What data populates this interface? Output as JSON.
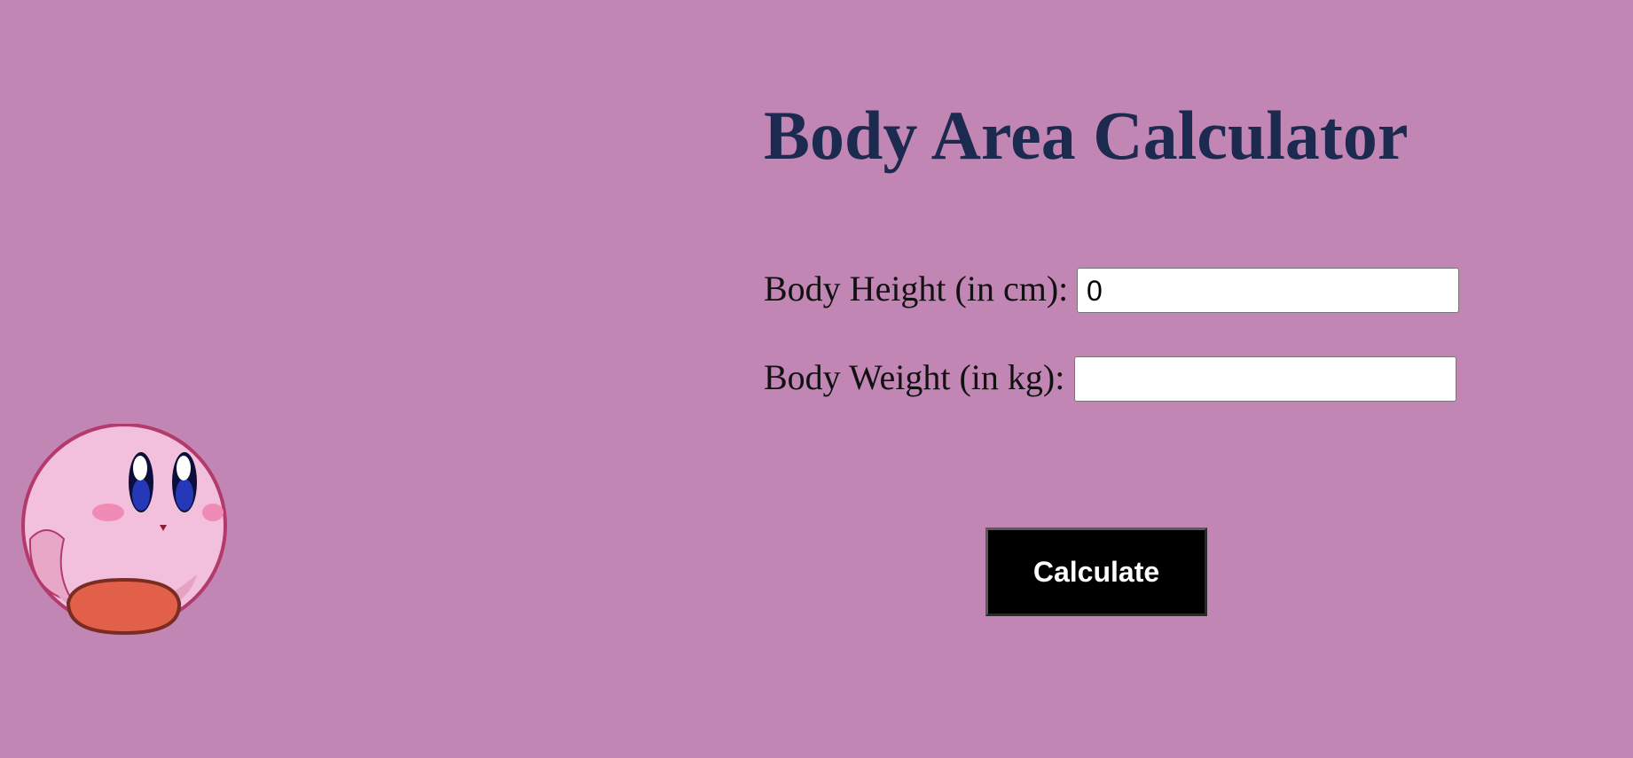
{
  "page": {
    "title": "Body Area Calculator",
    "background_color": "#c286b5",
    "title_color": "#1b2a4e"
  },
  "form": {
    "height_label": "Body Height (in cm):",
    "height_value": "0",
    "weight_label": "Body Weight (in kg):",
    "weight_value": "",
    "calculate_label": "Calculate"
  },
  "mascot": {
    "icon": "pink-puffball-character-icon",
    "body_color": "#f2bfdc",
    "feet_color": "#e2604a"
  }
}
